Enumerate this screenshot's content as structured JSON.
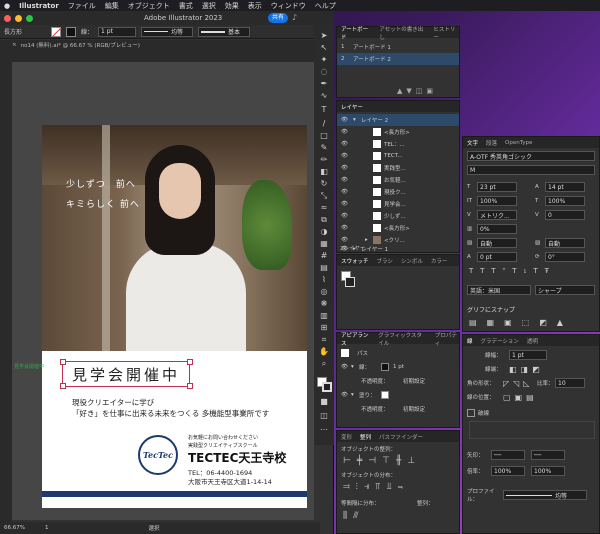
{
  "menubar": {
    "apple": "",
    "items": [
      "Illustrator",
      "ファイル",
      "編集",
      "オブジェクト",
      "書式",
      "選択",
      "効果",
      "表示",
      "ウィンドウ",
      "ヘルプ"
    ]
  },
  "titlebar": {
    "title": "Adobe Illustrator 2023",
    "share": "共有"
  },
  "control": {
    "selection": "長方形",
    "stroke_weight": "1 pt",
    "stroke_style": "均等",
    "brush": "基本"
  },
  "doc_tab": "no14 (無料).ai* @ 66.67 % (RGB/プレビュー)",
  "artboard": {
    "copy_line1": "少しずつ　前へ",
    "copy_line2": "キミらしく 前へ",
    "open_house": "見学会開催中",
    "tagline1": "現役クリエイターに学び",
    "tagline2": "「好き」を仕事に出来る未来をつくる 多機能型事業所です",
    "contact_small": "お気軽にお問い合わせください",
    "school_type": "実践型クリエイティブスクール",
    "school_name": "TECTEC天王寺校",
    "tel": "TEL：06-4400-1694",
    "address": "大阪市天王寺区大道1-14-14",
    "logo_text": "TecTec",
    "side_label": "見学会開催中"
  },
  "status": {
    "zoom": "66.67%",
    "page": "1",
    "tool": "選択"
  },
  "artboards_panel": {
    "tabs": [
      "アートボード",
      "アセットの書き出し",
      "ヒストリー"
    ],
    "rows": [
      {
        "num": "1",
        "name": "アートボード 1"
      },
      {
        "num": "2",
        "name": "アートボード 2"
      }
    ]
  },
  "layers_panel": {
    "tab": "レイヤー",
    "rows": [
      "レイヤー 2",
      "<長方形>",
      "TEL：...",
      "TECT...",
      "実践型...",
      "お気軽...",
      "現役ク...",
      "見学会...",
      "少しず...",
      "<長方形>",
      "<クリ...",
      "レイヤー 1"
    ],
    "footer": "2レイヤー"
  },
  "swatch_panel": {
    "tabs": [
      "スウォッチ",
      "ブラシ",
      "シンボル",
      "カラー"
    ]
  },
  "appearance_panel": {
    "tabs": [
      "アピアランス",
      "グラフィックスタイル",
      "プロパティ"
    ],
    "title": "パス",
    "stroke_label": "線：",
    "stroke_val": "1 pt",
    "opacity1": "不透明度：",
    "opacity1_val": "初期設定",
    "fill_label": "塗り：",
    "opacity2": "不透明度：",
    "opacity2_val": "初期設定"
  },
  "align_panel": {
    "tabs": [
      "変形",
      "整列",
      "パスファインダー"
    ],
    "objects_align": "オブジェクトの整列：",
    "objects_distribute": "オブジェクトの分布：",
    "spacing": "等間隔に分布：",
    "align_to": "整列："
  },
  "type_panel": {
    "tabs": [
      "文字",
      "段落",
      "OpenType"
    ],
    "font": "A-OTF 秀英角ゴシック",
    "style": "M",
    "size": "23 pt",
    "leading": "14 pt",
    "hscale": "100%",
    "vscale": "100%",
    "kerning": "メトリク...",
    "tracking": "0",
    "tsume": "0%",
    "aki1": "自動",
    "aki2": "自動",
    "baseline": "0 pt",
    "rotate": "0°",
    "lang": "英語：米国",
    "aa": "シャープ"
  },
  "snap_panel": {
    "title": "グリフにスナップ"
  },
  "stroke_panel": {
    "tabs": [
      "線",
      "グラデーション",
      "透明"
    ],
    "weight_label": "線幅：",
    "weight": "1 pt",
    "cap_label": "線端：",
    "corner_label": "角の形状：",
    "limit_label": "比率：",
    "limit": "10",
    "align_label": "線の位置：",
    "dashed": "破線",
    "arrow_label": "矢印：",
    "scale_label": "倍率：",
    "profile_label": "プロファイル：",
    "profile": "均等"
  }
}
